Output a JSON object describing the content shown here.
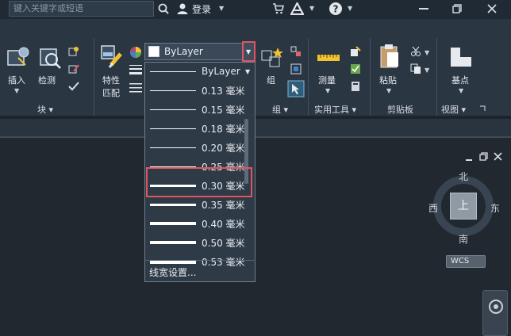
{
  "titlebar": {
    "search_placeholder": "键入关键字或短语",
    "login_label": "登录"
  },
  "ribbon": {
    "insert_label": "插入",
    "detect_label": "检测",
    "block_panel_title": "块 ▾",
    "properties_label_line1": "特性",
    "properties_label_line2": "匹配",
    "group_label": "组",
    "group_panel_title": "组 ▾",
    "measure_label": "测量",
    "utilities_panel_title": "实用工具 ▾",
    "paste_label": "粘贴",
    "clipboard_panel_title": "剪贴板",
    "basepoint_label": "基点",
    "view_panel_title": "视图 ▾"
  },
  "lineweight_combo": {
    "selected_value": "ByLayer",
    "list_header": "ByLayer"
  },
  "lineweight_list": [
    {
      "label": "0.13 毫米",
      "weight": 1
    },
    {
      "label": "0.15 毫米",
      "weight": 1
    },
    {
      "label": "0.18 毫米",
      "weight": 1
    },
    {
      "label": "0.20 毫米",
      "weight": 1
    },
    {
      "label": "0.25 毫米",
      "weight": 1
    },
    {
      "label": "0.30 毫米",
      "weight": 3
    },
    {
      "label": "0.35 毫米",
      "weight": 3
    },
    {
      "label": "0.40 毫米",
      "weight": 4
    },
    {
      "label": "0.50 毫米",
      "weight": 4
    },
    {
      "label": "0.53 毫米",
      "weight": 5
    }
  ],
  "lineweight_settings_label": "线宽设置...",
  "viewcube": {
    "north": "北",
    "south": "南",
    "east": "东",
    "west": "西",
    "top_face": "上",
    "wcs_label": "WCS"
  },
  "colors": {
    "accent_highlight": "#e0555f",
    "ribbon_bg": "#2b3643",
    "canvas_bg": "#212830"
  }
}
